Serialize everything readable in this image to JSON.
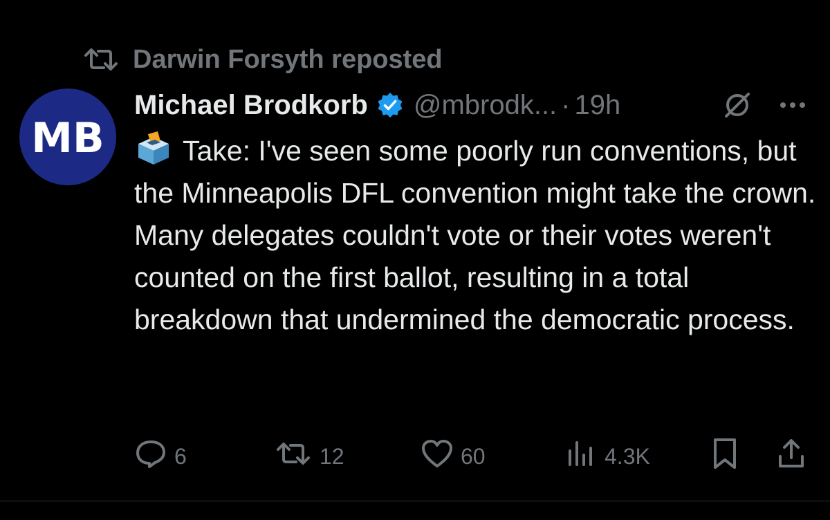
{
  "repost": {
    "text": "Darwin Forsyth reposted",
    "icon": "repost-icon"
  },
  "author": {
    "display_name": "Michael Brodkorb",
    "handle": "@mbrodk...",
    "separator": "·",
    "timestamp": "19h",
    "avatar_text": "MB",
    "verified_icon": "verified-badge-icon"
  },
  "tweet": {
    "emoji_icon": "ballot-box-icon",
    "text": "Take: I've seen some poorly run conventions, but the Minneapolis DFL convention might take the crown. Many delegates couldn't vote or their votes weren't counted on the first ballot, resulting in a total breakdown that undermined the democratic process."
  },
  "actions": {
    "replies": "6",
    "reposts": "12",
    "likes": "60",
    "views": "4.3K"
  },
  "colors": {
    "background": "#000000",
    "text_primary": "#e7e9ea",
    "text_secondary": "#71767b",
    "verified_blue": "#1d9bf0",
    "avatar_bg": "#1d2a85"
  }
}
